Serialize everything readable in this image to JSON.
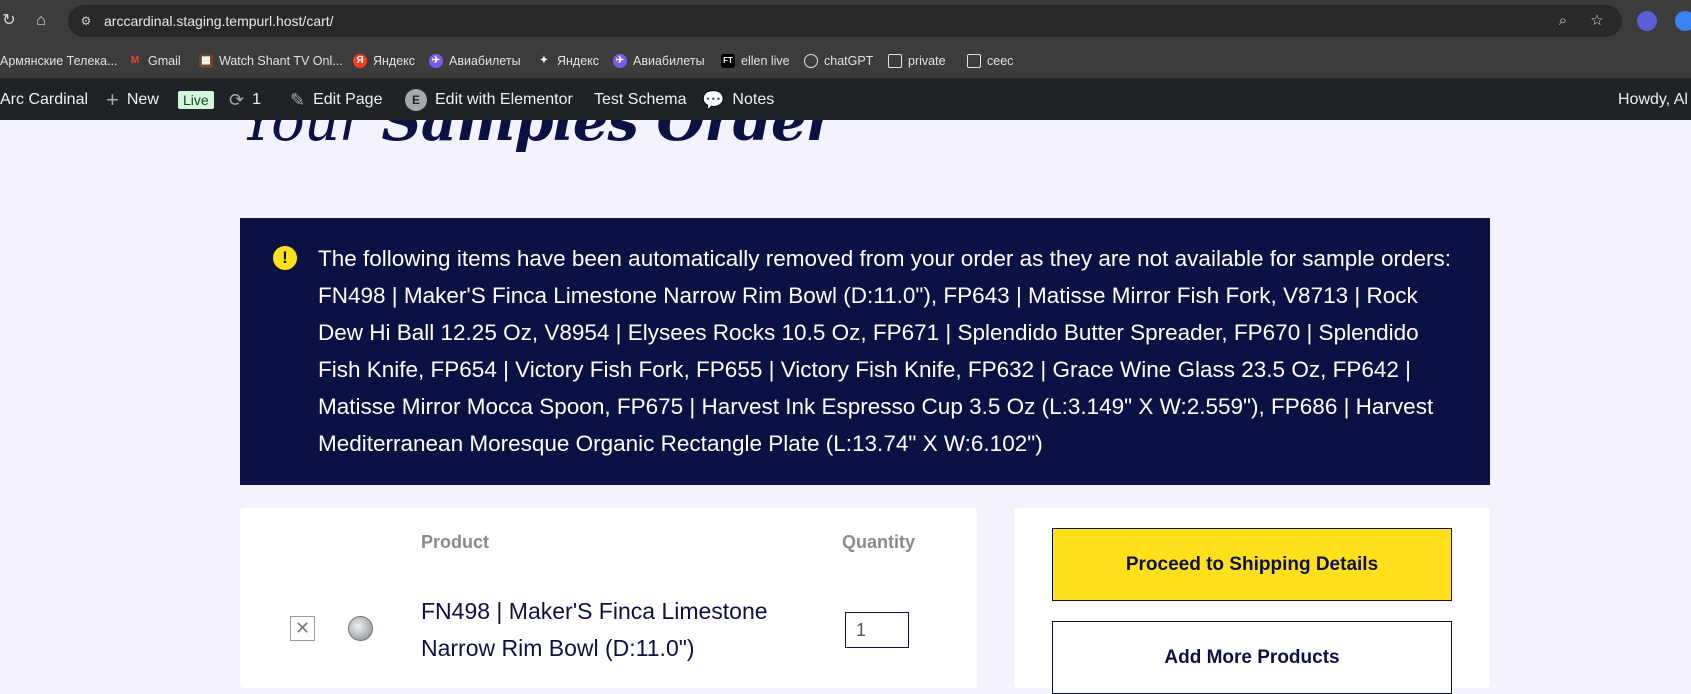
{
  "browser": {
    "url": "arccardinal.staging.tempurl.host/cart/",
    "icons": [
      "reload-icon",
      "home-icon",
      "site-info-icon",
      "zoom-icon",
      "bookmark-star-icon",
      "extension-icon",
      "profile-icon"
    ]
  },
  "bookmarks": [
    {
      "label": "Армянские Телека...",
      "icon": "folder"
    },
    {
      "label": "Gmail",
      "icon": "gmail"
    },
    {
      "label": "Watch Shant TV Onl...",
      "icon": "tv"
    },
    {
      "label": "Яндекс",
      "icon": "yandex"
    },
    {
      "label": "Авиабилеты",
      "icon": "aviasales"
    },
    {
      "label": "Яндекс",
      "icon": "yandex-star"
    },
    {
      "label": "Авиабилеты",
      "icon": "aviasales"
    },
    {
      "label": "ellen live",
      "icon": "ft"
    },
    {
      "label": "chatGPT",
      "icon": "openai"
    },
    {
      "label": "private",
      "icon": "folder"
    },
    {
      "label": "ceec",
      "icon": "folder"
    }
  ],
  "admin_bar": {
    "site_name": "Arc Cardinal",
    "new_label": "New",
    "live_badge": "Live",
    "updates_count": "1",
    "edit_page": "Edit Page",
    "edit_elementor": "Edit with Elementor",
    "test_schema": "Test Schema",
    "notes": "Notes",
    "howdy": "Howdy, Al"
  },
  "page": {
    "title_light": "Your ",
    "title_bold": "Samples Order"
  },
  "notice": {
    "text": "The following items have been automatically removed from your order as they are not available for sample orders: FN498 | Maker'S Finca Limestone Narrow Rim Bowl (D:11.0\"), FP643 | Matisse Mirror Fish Fork, V8713 | Rock Dew Hi Ball 12.25 Oz, V8954 | Elysees Rocks 10.5 Oz, FP671 | Splendido Butter Spreader, FP670 | Splendido Fish Knife, FP654 | Victory Fish Fork, FP655 | Victory Fish Knife, FP632 | Grace Wine Glass 23.5 Oz, FP642 | Matisse Mirror Mocca Spoon, FP675 | Harvest Ink Espresso Cup 3.5 Oz (L:3.149\" X W:2.559\"), FP686 | Harvest Mediterranean Moresque Organic Rectangle Plate (L:13.74\" X W:6.102\")"
  },
  "cart": {
    "headers": {
      "product": "Product",
      "quantity": "Quantity"
    },
    "items": [
      {
        "name": "FN498 | Maker'S Finca Limestone Narrow Rim Bowl (D:11.0\")",
        "quantity": "1"
      }
    ]
  },
  "summary": {
    "proceed_label": "Proceed to Shipping Details",
    "add_more_label": "Add More Products"
  },
  "colors": {
    "navy": "#0c1144",
    "yellow": "#ffe01b",
    "page_bg": "#f4f2fd",
    "admin_bar": "#1d2327"
  }
}
